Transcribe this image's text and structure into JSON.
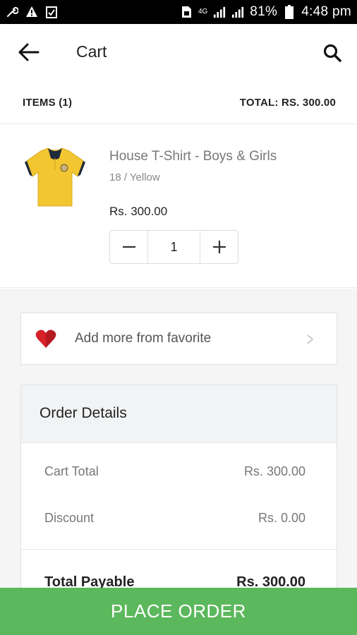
{
  "status_bar": {
    "network": "4G",
    "battery": "81%",
    "time": "4:48 pm"
  },
  "header": {
    "title": "Cart",
    "back_icon": "arrow-left-icon",
    "search_icon": "search-icon"
  },
  "summary": {
    "items_label": "ITEMS (1)",
    "total_label": "TOTAL: RS. 300.00"
  },
  "cart_items": [
    {
      "name": "House T-Shirt - Boys & Girls",
      "variant": "18 / Yellow",
      "price": "Rs. 300.00",
      "quantity": "1",
      "image_icon": "yellow-tshirt-image"
    }
  ],
  "favorite": {
    "label": "Add more from favorite",
    "icon": "heart-icon"
  },
  "order_details": {
    "title": "Order Details",
    "rows": [
      {
        "label": "Cart Total",
        "value": "Rs. 300.00"
      },
      {
        "label": "Discount",
        "value": "Rs. 0.00"
      }
    ],
    "total": {
      "label": "Total Payable",
      "value": "Rs. 300.00"
    }
  },
  "footer": {
    "place_order_label": "PLACE ORDER"
  },
  "colors": {
    "primary_button": "#5cb85c",
    "heart": "#d62128",
    "tshirt_yellow": "#f2c631"
  }
}
